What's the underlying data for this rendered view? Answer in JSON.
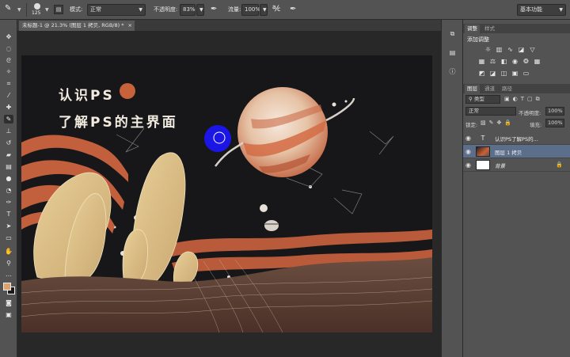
{
  "options_bar": {
    "brush_size": "125",
    "mode_label": "模式:",
    "mode_value": "正常",
    "opacity_label": "不透明度:",
    "opacity_value": "83%",
    "flow_label": "流量:",
    "flow_value": "100%",
    "workspace_value": "基本功能"
  },
  "document": {
    "tab_title": "未标题-1 @ 21.3% (图层 1 拷贝, RGB/8) *",
    "close_glyph": "×",
    "heading_line1": "认识PS",
    "heading_line2": "了解PS的主界面"
  },
  "adjustments_panel": {
    "tab_adjust": "调整",
    "tab_styles": "样式",
    "add_adjustment_label": "添加调整"
  },
  "layers_panel": {
    "tab_layers": "图层",
    "tab_channels": "通道",
    "tab_paths": "路径",
    "filter_kind": "类型",
    "blend_mode": "正常",
    "opacity_label": "不透明度:",
    "opacity_value": "100%",
    "lock_label": "锁定:",
    "fill_label": "填充:",
    "fill_value": "100%",
    "layers": [
      {
        "name": "认识PS了解PS的..."
      },
      {
        "name": "图层 1 拷贝"
      },
      {
        "name": "背景"
      }
    ]
  },
  "colors": {
    "foreground": "#d9a36b",
    "background": "#1a1a1a",
    "brush_cursor": "#1b16e6",
    "accent_orange": "#c7623a"
  }
}
